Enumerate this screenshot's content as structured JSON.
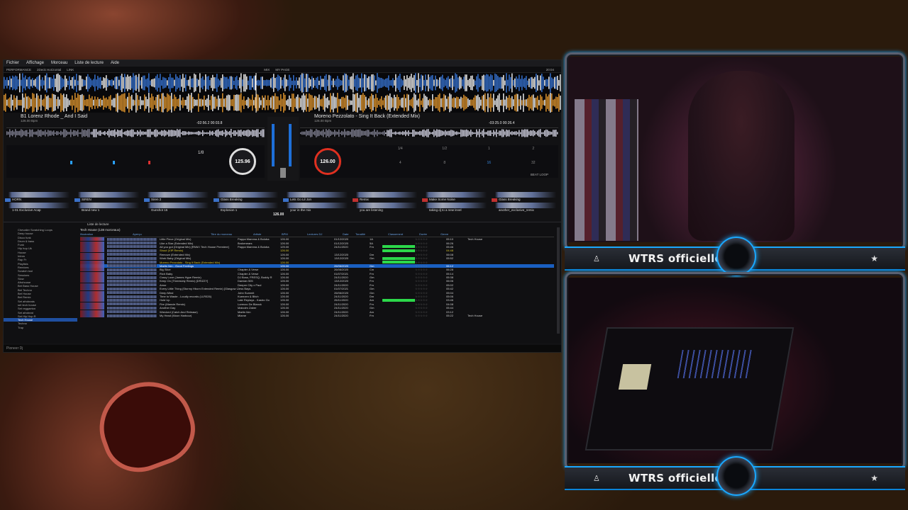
{
  "rekordbox": {
    "menu": [
      "Fichier",
      "Affichage",
      "Morceau",
      "Liste de lecture",
      "Aide"
    ],
    "toolbar": {
      "mode": "PERFORMANCE",
      "layout": "2Deck Horizontal",
      "link": "LINK",
      "mix": "MIX",
      "my_page": "MY PAGE",
      "clock": "20:04"
    },
    "deck1": {
      "title": "B1 Lorenz Rhode _ And I Said",
      "bpm": "125.96",
      "sub_bpm": "126.00 Bpm",
      "time_remaining": "-02:56.2",
      "time_elapsed": "00:03.8",
      "key": "Key"
    },
    "deck2": {
      "title": "Moreno Pezzolato - Sing It Back (Extended Mix)",
      "bpm": "126.00",
      "sub_bpm": "126.00 Bpm",
      "time_remaining": "-03:25.0",
      "time_elapsed": "00:26.4",
      "beat_loop": "BEAT LOOP"
    },
    "deck1_loop_values": [
      "1/8",
      "1/2",
      "1",
      "2"
    ],
    "deck2_loop_values": [
      "1/4",
      "1/2",
      "1",
      "2",
      "4",
      "8",
      "16",
      "32"
    ],
    "master_bpm": "126.00",
    "sampler_labels": [
      "HORN",
      "SIREN",
      "Siren 2",
      "Glass Breaking",
      "Lets Go Lil Jon",
      "Remix",
      "Make Some Noise",
      "Glass Breaking"
    ],
    "sampler_labels_2": [
      "1-01 Exclusive Acap",
      "Brand new 1",
      "Gunshot 15",
      "Explosion 1",
      "your in the mix",
      "you are listening",
      "taking dj to a new level",
      "another_exclusive_remix"
    ],
    "browser": {
      "playlist_title": "Tech House (138 morceaux)",
      "filter_label": "Liste de lecture",
      "columns": [
        "Illustration",
        "Aperçu",
        "Titre du morceau",
        "Artiste",
        "BPM",
        "Lectures DJ",
        "Date d'ajout",
        "Tonalité",
        "Classement",
        "Durée",
        "Genre"
      ],
      "tree": [
        "Chevalier Scratching Loops",
        "Deep house",
        "Disco funk",
        "Drum & bass",
        "Funk",
        "Hip hop Uk",
        "House",
        "Intros",
        "Rap Fr",
        "Playlists",
        "Remixes",
        "Scratch tool",
        "Sessions",
        "Slow",
        "Afrohouse",
        "Bet Bass House",
        "Bet Techno",
        "Bet House",
        "Bet Remix",
        "Set afrobeats",
        "set tech house",
        "Set reggaeton",
        "Set afrobeat",
        "Set Hip Hop R",
        "Tech House",
        "Techno",
        "Trap"
      ],
      "tracks": [
        {
          "title": "Little Piece (Original Mix)",
          "artist": "Pappa Mamma & Boloba",
          "bpm": "126.00",
          "time": "01/12/2020",
          "key": "1A",
          "bar": false,
          "len": "05:10",
          "genre": "Tech House"
        },
        {
          "title": "Like a Star (Extended Mix)",
          "artist": "Brokenears",
          "bpm": "126.00",
          "time": "01/12/2020",
          "key": "5A",
          "bar": false,
          "len": "06:26",
          "genre": ""
        },
        {
          "title": "All you got (Original Mix) [RNM I Tech House Premiere]",
          "artist": "Pappa Mamma & Boloba",
          "bpm": "125.00",
          "time": "24/11/2020",
          "key": "Fm",
          "bar": true,
          "len": "05:46",
          "genre": ""
        },
        {
          "title": "Shout (VIP Remix)",
          "artist": "",
          "bpm": "126.00",
          "time": "",
          "key": "",
          "bar": true,
          "len": "04:48",
          "genre": "",
          "hl": true
        },
        {
          "title": "Remove (Extended Mix)",
          "artist": "",
          "bpm": "126.00",
          "time": "13/12/2020",
          "key": "Dm",
          "bar": false,
          "len": "06:08",
          "genre": ""
        },
        {
          "title": "Work Baby (Original Mix)",
          "artist": "",
          "bpm": "126.00",
          "time": "13/12/2020",
          "key": "Gm",
          "bar": true,
          "len": "05:52",
          "genre": ""
        },
        {
          "title": "Moreno Pezzolato - Sing It Back (Extended Mix)",
          "artist": "",
          "bpm": "126.00",
          "time": "",
          "key": "",
          "bar": true,
          "len": "",
          "genre": "",
          "hl": true
        },
        {
          "title": "Martin Ikin - Good Feelings",
          "artist": "",
          "bpm": "126.00",
          "time": "26/06/2020",
          "key": "Gm",
          "bar": false,
          "len": "06:12",
          "genre": "",
          "sel": true
        },
        {
          "title": "Big Slice",
          "artist": "Chapter & Verse",
          "bpm": "126.00",
          "time": "26/06/2020",
          "key": "Cm",
          "bar": false,
          "len": "06:28",
          "genre": ""
        },
        {
          "title": "Rich Baby",
          "artist": "Chapter & Verse",
          "bpm": "126.00",
          "time": "01/07/2021",
          "key": "Fm",
          "bar": false,
          "len": "05:14",
          "genre": ""
        },
        {
          "title": "Crazy Love (James Hype Remix)",
          "artist": "DJ Boss, FRESQ, Buddy R",
          "bpm": "126.00",
          "time": "24/11/2020",
          "key": "Gm",
          "bar": false,
          "len": "05:38",
          "genre": ""
        },
        {
          "title": "Keep On (Threesixty Remix) [DRIZZY]",
          "artist": "Damian 505",
          "bpm": "126.00",
          "time": "13/12/2020",
          "key": "Fm",
          "bar": false,
          "len": "06:06",
          "genre": ""
        },
        {
          "title": "Amor",
          "artist": "Deeper City x Paul",
          "bpm": "126.00",
          "time": "24/11/2020",
          "key": "Fm",
          "bar": false,
          "len": "05:02",
          "genre": ""
        },
        {
          "title": "Every Little Thing (Stormy Hborn Extended Remix) [Glasgow Underground]",
          "artist": "Jess Bays",
          "bpm": "126.00",
          "time": "01/07/2021",
          "key": "Gm",
          "bar": false,
          "len": "05:42",
          "genre": ""
        },
        {
          "title": "Deep Mind",
          "artist": "John Summit",
          "bpm": "126.00",
          "time": "26/06/2020",
          "key": "Gm",
          "bar": false,
          "len": "05:04",
          "genre": ""
        },
        {
          "title": "Time to Waste - Loudly records (LLR026)",
          "artist": "Kueezen & Bitch",
          "bpm": "126.00",
          "time": "24/11/2020",
          "key": "Dm",
          "bar": false,
          "len": "05:06",
          "genre": ""
        },
        {
          "title": "Hold Up",
          "artist": "Late Replays - Kastro Go",
          "bpm": "126.00",
          "time": "26/11/2020",
          "key": "Am",
          "bar": true,
          "len": "03:46",
          "genre": ""
        },
        {
          "title": "Fire (Mancie Remix)",
          "artist": "Lorenzo De Blanck",
          "bpm": "126.00",
          "time": "24/11/2020",
          "key": "Fm",
          "bar": false,
          "len": "04:08",
          "genre": ""
        },
        {
          "title": "Another Day",
          "artist": "Malcolm Zaber",
          "bpm": "126.00",
          "time": "24/11/2020",
          "key": "Gm",
          "bar": false,
          "len": "05:44",
          "genre": ""
        },
        {
          "title": "Wrecked (Catch And Release)",
          "artist": "Martin Ikin",
          "bpm": "126.00",
          "time": "24/11/2020",
          "key": "Am",
          "bar": false,
          "len": "03:12",
          "genre": ""
        },
        {
          "title": "My Head (Moon Harbour)",
          "artist": "Mlame",
          "bpm": "126.00",
          "time": "24/11/2020",
          "key": "Fm",
          "bar": false,
          "len": "05:22",
          "genre": "Tech House"
        }
      ]
    },
    "statusbar": "Pioneer Dj"
  },
  "overlay": {
    "cam_top_name": "WTRS officielle",
    "cam_bottom_name": "WTRS officielle"
  },
  "colors": {
    "accent": "#1aa8ff",
    "wave_orange": "#f0a030",
    "wave_blue": "#3a7ae0",
    "select_blue": "#1a5fc0",
    "green": "#2cd84a"
  }
}
